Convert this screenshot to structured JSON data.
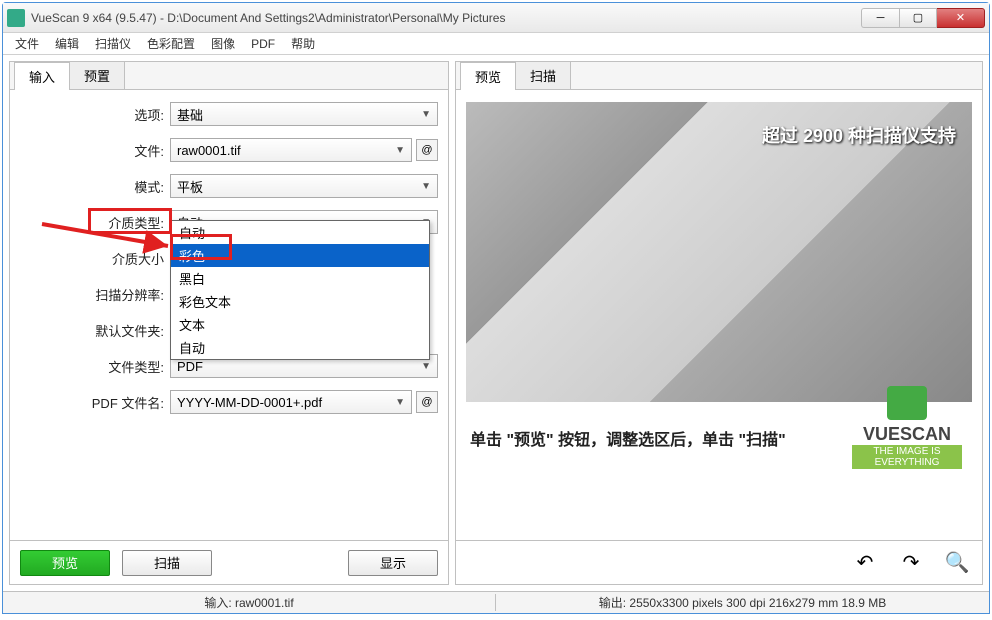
{
  "window": {
    "title": "VueScan 9 x64 (9.5.47) - D:\\Document And Settings2\\Administrator\\Personal\\My Pictures"
  },
  "menu": [
    "文件",
    "编辑",
    "扫描仪",
    "色彩配置",
    "图像",
    "PDF",
    "帮助"
  ],
  "left": {
    "tabs": {
      "input": "输入",
      "preset": "预置"
    },
    "options_label": "选项:",
    "options_value": "基础",
    "file_label": "文件:",
    "file_value": "raw0001.tif",
    "mode_label": "模式:",
    "mode_value": "平板",
    "media_type_label": "介质类型:",
    "media_type_value": "自动",
    "media_size_label": "介质大小",
    "resolution_label": "扫描分辨率:",
    "default_folder_label": "默认文件夹:",
    "file_type_label": "文件类型:",
    "file_type_value": "PDF",
    "pdf_name_label": "PDF 文件名:",
    "pdf_name_value": "YYYY-MM-DD-0001+.pdf",
    "dropdown": [
      "自动",
      "彩色",
      "黑白",
      "彩色文本",
      "文本",
      "自动"
    ]
  },
  "buttons": {
    "preview": "预览",
    "scan": "扫描",
    "display": "显示"
  },
  "right": {
    "tabs": {
      "preview": "预览",
      "scan": "扫描"
    },
    "overlay": "超过 2900 种扫描仪支持",
    "hint": "单击 \"预览\" 按钮，调整选区后，单击 \"扫描\"",
    "logo_top": "VUESCAN",
    "logo_bot": "THE IMAGE IS EVERYTHING"
  },
  "status": {
    "left": "输入: raw0001.tif",
    "right": "输出: 2550x3300 pixels 300 dpi 216x279 mm 18.9 MB"
  }
}
